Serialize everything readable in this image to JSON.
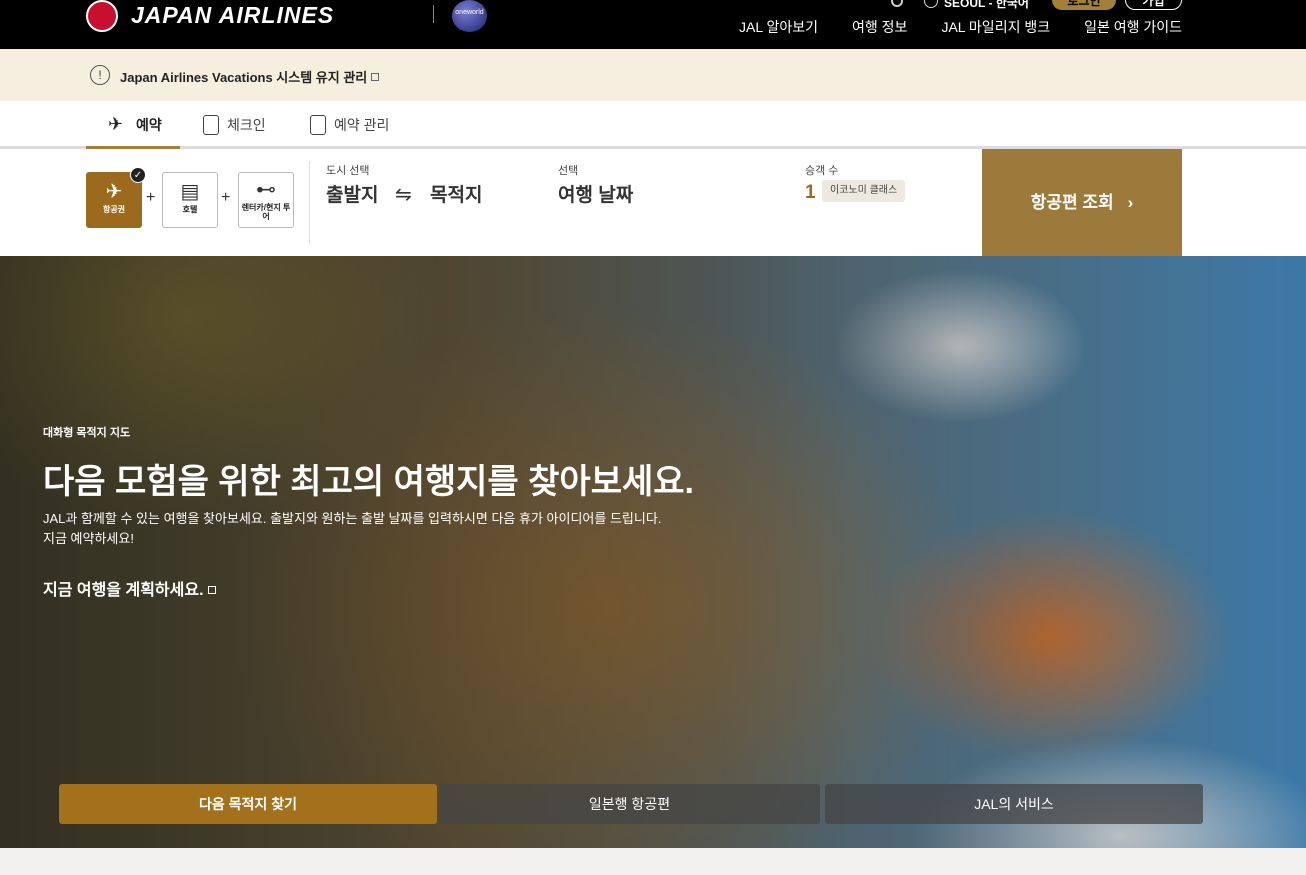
{
  "header": {
    "logo_text": "JAPAN AIRLINES",
    "oneworld_text": "oneworld",
    "locale": "SEOUL - 한국어",
    "login": "로그인",
    "join": "가입",
    "nav": [
      "JAL 알아보기",
      "여행 정보",
      "JAL 마일리지 뱅크",
      "일본 여행 가이드"
    ]
  },
  "notice": {
    "icon": "!",
    "text": "Japan Airlines Vacations 시스템 유지 관리"
  },
  "tabs": [
    {
      "label": "예약",
      "icon": "plane-icon",
      "active": true
    },
    {
      "label": "체크인",
      "icon": "passport-icon",
      "active": false
    },
    {
      "label": "예약 관리",
      "icon": "document-icon",
      "active": false
    }
  ],
  "search": {
    "products": [
      {
        "label": "항공권",
        "icon": "plane-icon",
        "active": true
      },
      {
        "label": "호텔",
        "icon": "bed-icon",
        "active": false
      },
      {
        "label": "렌터카/현지 투어",
        "icon": "car-icon",
        "active": false
      }
    ],
    "city_label": "도시 선택",
    "origin": "출발지",
    "destination": "목적지",
    "date_label": "선택",
    "date_value": "여행 날짜",
    "pax_label": "승객 수",
    "pax_count": "1",
    "cabin_class": "이코노미 클래스",
    "submit": "항공편 조회"
  },
  "hero": {
    "eyebrow": "대화형 목적지 지도",
    "title": "다음 모험을 위한 최고의 여행지를 찾아보세요.",
    "description_line1": "JAL과 함께할 수 있는 여행을 찾아보세요. 출발지와 원하는 출발 날짜를 입력하시면 다음 휴가 아이디어를 드립니다.",
    "description_line2": "지금 예약하세요!",
    "link": "지금 여행을 계획하세요.",
    "tabs": [
      {
        "label": "다음 목적지 찾기",
        "active": true
      },
      {
        "label": "일본행 항공편",
        "active": false
      },
      {
        "label": "JAL의 서비스",
        "active": false
      }
    ]
  },
  "colors": {
    "accent": "#9c7a3c",
    "active_tab": "#a3701c",
    "header_bg": "#000000",
    "notice_bg": "#f6efe0"
  }
}
